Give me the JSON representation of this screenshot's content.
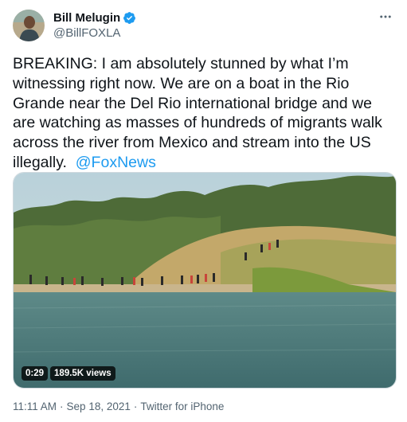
{
  "author": {
    "display_name": "Bill Melugin",
    "handle": "@BillFOXLA",
    "verified_badge_icon": "verified-badge-icon",
    "avatar_icon": "user-avatar"
  },
  "tweet": {
    "text": "BREAKING: I am absolutely stunned by what I’m witnessing right now. We are on a boat in the Rio Grande near the Del Rio international bridge and we are watching as masses of hundreds of migrants walk across the river from Mexico and stream into the US illegally.",
    "mention": "@FoxNews"
  },
  "media": {
    "type": "video",
    "duration": "0:29",
    "views": "189.5K views"
  },
  "meta": {
    "time": "11:11 AM",
    "separator1": "·",
    "date": "Sep 18, 2021",
    "separator2": "·",
    "source": "Twitter for iPhone"
  },
  "colors": {
    "accent": "#1d9bf0",
    "text": "#0f1419",
    "secondary": "#536471"
  },
  "icons": {
    "more": "more-dots-icon"
  }
}
